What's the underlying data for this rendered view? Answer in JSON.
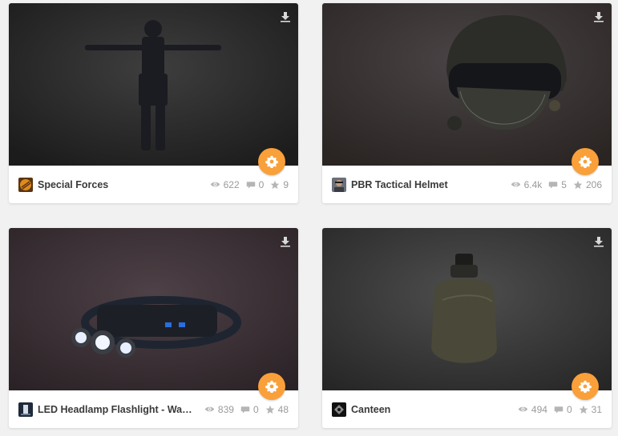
{
  "colors": {
    "accent": "#f9a03a",
    "card_bg": "#ffffff",
    "page_bg": "#f1f1f1",
    "text": "#3a3a3a",
    "muted": "#9a9a9a"
  },
  "icons": {
    "views": "eye-icon",
    "comments": "comment-icon",
    "likes": "star-icon",
    "download": "download-icon",
    "options": "gear-icon"
  },
  "models": [
    {
      "title": "Special Forces",
      "views": "622",
      "comments": "0",
      "likes": "9"
    },
    {
      "title": "PBR Tactical Helmet",
      "views": "6.4k",
      "comments": "5",
      "likes": "206"
    },
    {
      "title": "LED Headlamp Flashlight - Waterproof",
      "views": "839",
      "comments": "0",
      "likes": "48"
    },
    {
      "title": "Canteen",
      "views": "494",
      "comments": "0",
      "likes": "31"
    }
  ]
}
